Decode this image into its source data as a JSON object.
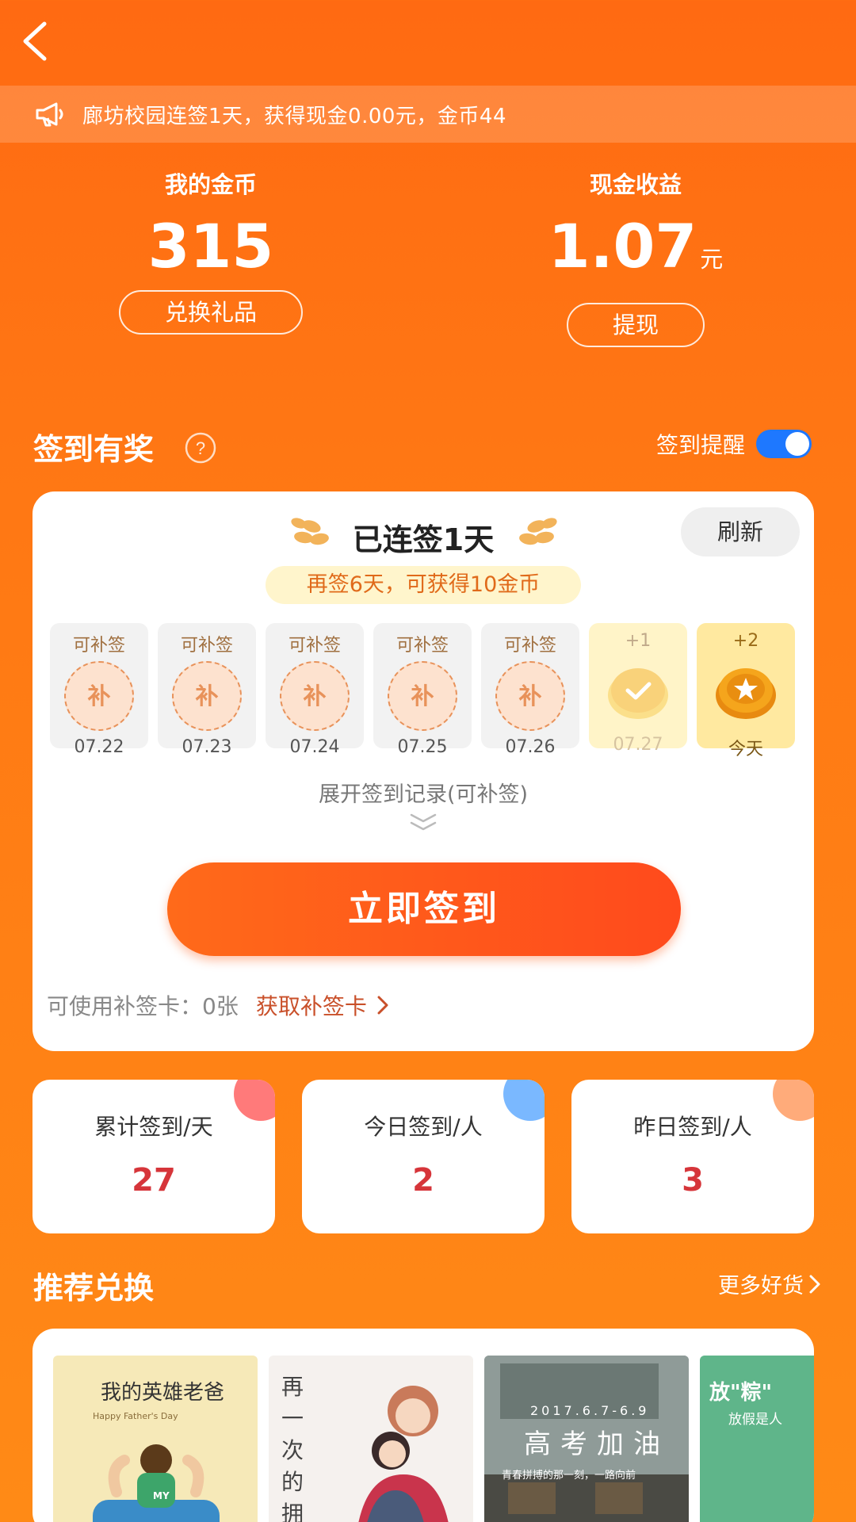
{
  "notice": {
    "text": "廊坊校园连签1天，获得现金0.00元，金币44"
  },
  "coins": {
    "label": "我的金币",
    "value": "315",
    "button": "兑换礼品"
  },
  "cash": {
    "label": "现金收益",
    "value": "1.07",
    "unit": "元",
    "button": "提现"
  },
  "signin": {
    "section_title": "签到有奖",
    "reminder_label": "签到提醒",
    "reminder_on": true,
    "streak_title": "已连签1天",
    "refresh_label": "刷新",
    "streak_hint": "再签6天，可获得10金币",
    "days": [
      {
        "top": "可补签",
        "badge": "补",
        "date": "07.22"
      },
      {
        "top": "可补签",
        "badge": "补",
        "date": "07.23"
      },
      {
        "top": "可补签",
        "badge": "补",
        "date": "07.24"
      },
      {
        "top": "可补签",
        "badge": "补",
        "date": "07.25"
      },
      {
        "top": "可补签",
        "badge": "补",
        "date": "07.26"
      },
      {
        "top": "+1",
        "date": "07.27"
      },
      {
        "top": "+2",
        "date": "今天"
      }
    ],
    "expand_label": "展开签到记录(可补签)",
    "signin_button": "立即签到",
    "makeup_label": "可使用补签卡：0张",
    "makeup_link": "获取补签卡"
  },
  "stats": [
    {
      "label": "累计签到/天",
      "value": "27",
      "color": "#ff7a7a"
    },
    {
      "label": "今日签到/人",
      "value": "2",
      "color": "#7ab8ff"
    },
    {
      "label": "昨日签到/人",
      "value": "3",
      "color": "#ffab7a"
    }
  ],
  "recommend": {
    "title": "推荐兑换",
    "more_label": "更多好货",
    "items": [
      {
        "caption": "我的英雄老爸",
        "sub": "Happy Father's Day",
        "badge": "MY"
      },
      {
        "caption": "再一次的拥抱"
      },
      {
        "caption": "高考加油",
        "sub": "2017.6.7-6.9",
        "tagline": "青春拼搏的那一刻，一路向前"
      },
      {
        "caption": "放\"粽\"",
        "sub": "放假是人"
      }
    ]
  }
}
